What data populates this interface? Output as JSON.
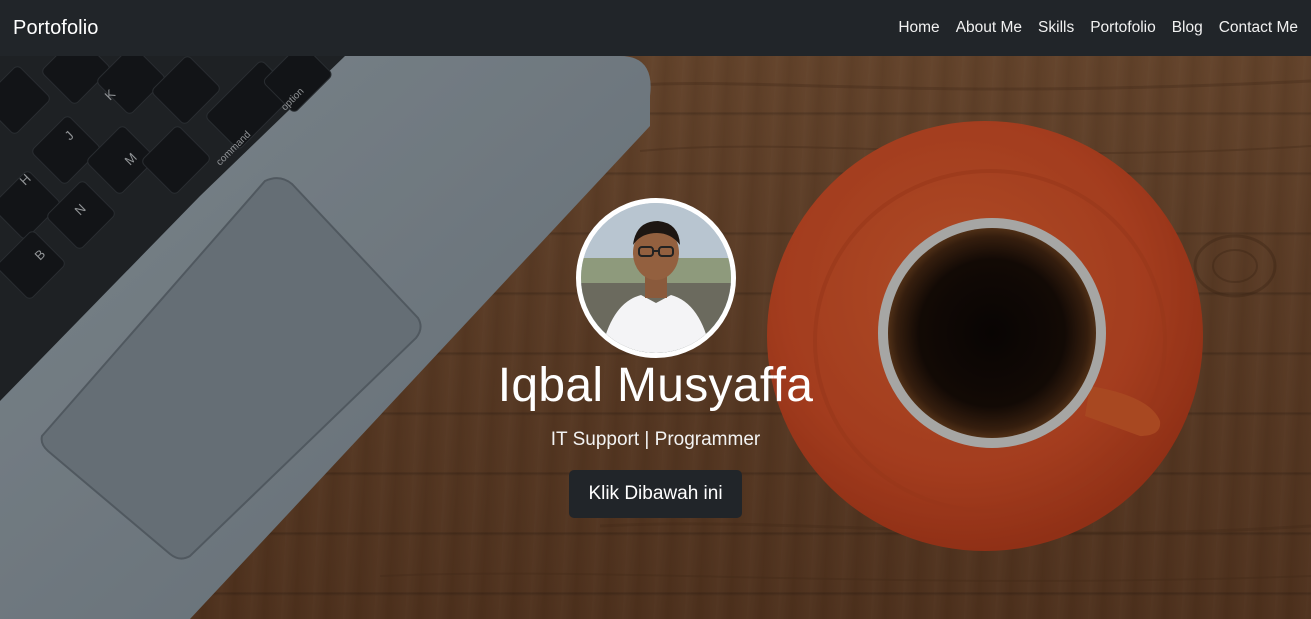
{
  "navbar": {
    "brand": "Portofolio",
    "links": [
      "Home",
      "About Me",
      "Skills",
      "Portofolio",
      "Blog",
      "Contact Me"
    ]
  },
  "hero": {
    "name": "Iqbal Musyaffa",
    "subtitle": "IT Support | Programmer",
    "button_label": "Klik Dibawah ini"
  },
  "laptop_keys": [
    "N",
    "M",
    "B",
    "H",
    "J",
    "K",
    "command",
    "option"
  ],
  "colors": {
    "navbar_bg": "#212529",
    "button_bg": "#212529",
    "saucer": "#e8572a",
    "wood": "#7d5233"
  }
}
